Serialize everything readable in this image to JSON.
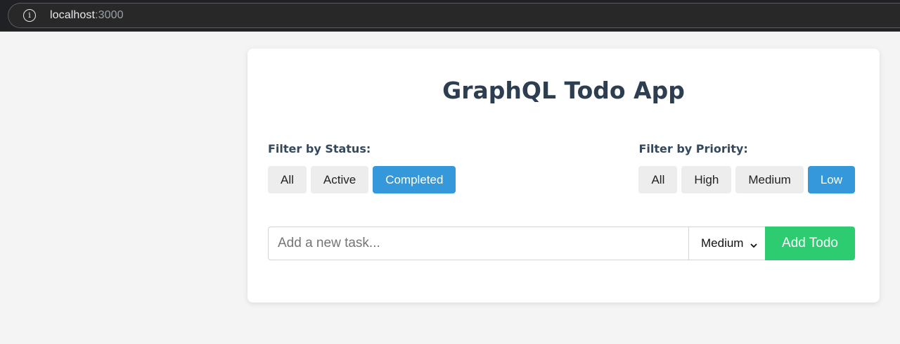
{
  "browser": {
    "url_host": "localhost",
    "url_port": ":3000",
    "info_icon": "info-icon"
  },
  "app": {
    "title": "GraphQL Todo App"
  },
  "status_filter": {
    "label": "Filter by Status:",
    "options": [
      "All",
      "Active",
      "Completed"
    ],
    "selected": "Completed"
  },
  "priority_filter": {
    "label": "Filter by Priority:",
    "options": [
      "All",
      "High",
      "Medium",
      "Low"
    ],
    "selected": "Low"
  },
  "new_todo": {
    "placeholder": "Add a new task...",
    "value": "",
    "priority_selected": "Medium",
    "add_label": "Add Todo"
  },
  "colors": {
    "active_filter": "#3498db",
    "add_button": "#2ecc71",
    "title": "#2c3e50"
  }
}
